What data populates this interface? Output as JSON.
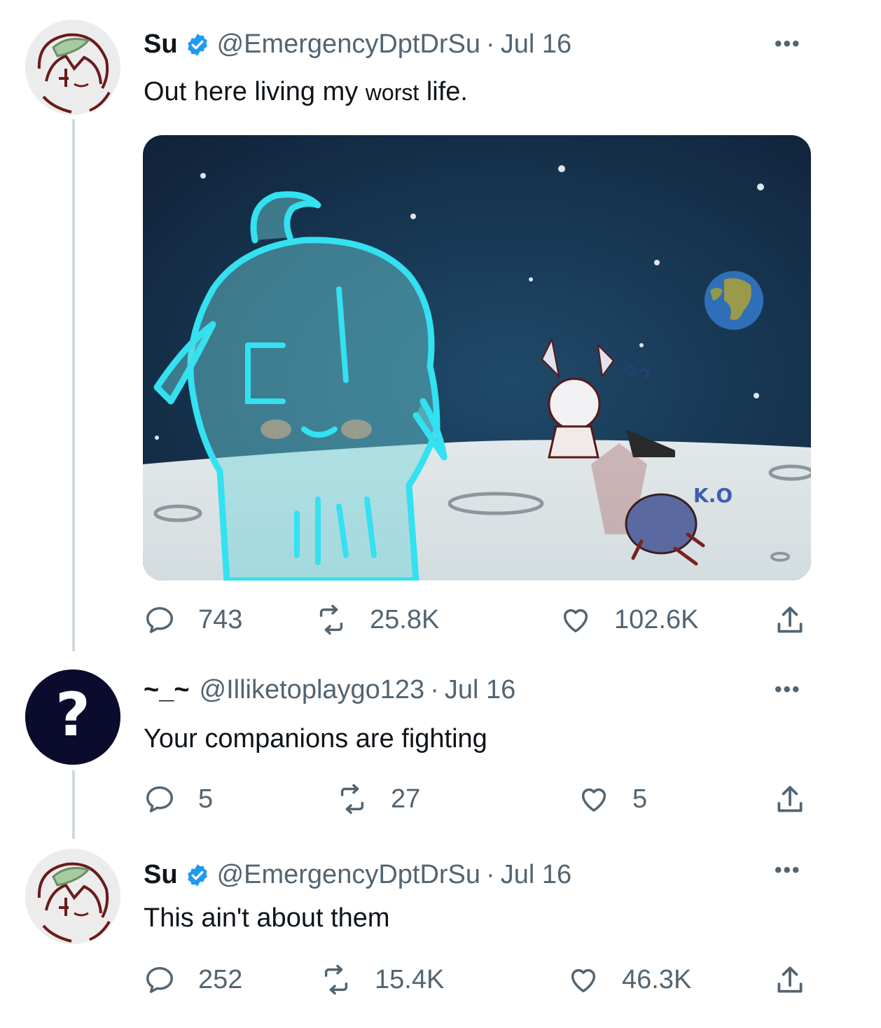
{
  "thread": [
    {
      "author_name": "Su",
      "handle": "@EmergencyDptDrSu",
      "date": "Jul 16",
      "text": "Out here living my",
      "text_small": "worst",
      "text_end": "life.",
      "verified": true,
      "has_image": true,
      "image_text": "K.O",
      "stats": {
        "replies": "743",
        "retweets": "25.8K",
        "likes": "102.6K"
      }
    },
    {
      "author_name": "~_~",
      "handle": "@Illiketoplaygo123",
      "date": "Jul 16",
      "text": "Your companions are fighting",
      "verified": false,
      "avatar_symbol": "?",
      "stats": {
        "replies": "5",
        "retweets": "27",
        "likes": "5"
      }
    },
    {
      "author_name": "Su",
      "handle": "@EmergencyDptDrSu",
      "date": "Jul 16",
      "text": "This ain't about them",
      "verified": true,
      "stats": {
        "replies": "252",
        "retweets": "15.4K",
        "likes": "46.3K"
      }
    }
  ],
  "more_label": "•••",
  "separator": "·",
  "colors": {
    "verified": "#1d9bf0",
    "secondary_text": "#536471",
    "thread_line": "#cfd9de",
    "sky": "#152a45",
    "moon": "#dfe6e8",
    "glow": "#33e1f0"
  }
}
